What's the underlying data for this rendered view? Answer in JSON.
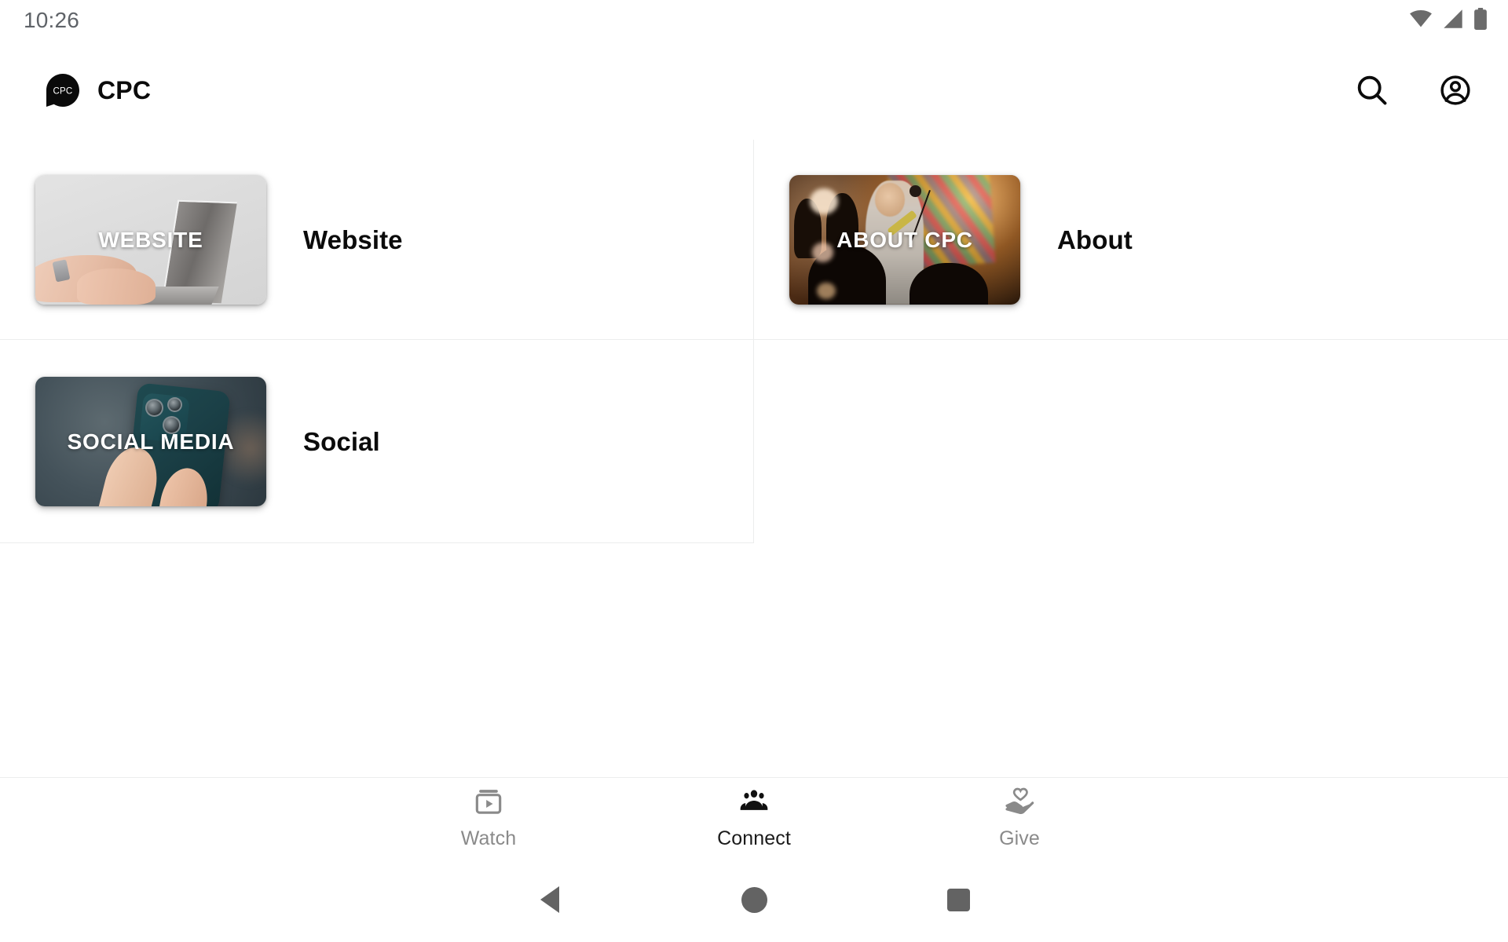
{
  "status_bar": {
    "time": "10:26",
    "icons": [
      "wifi-icon",
      "cellular-signal-icon",
      "battery-icon"
    ],
    "color": "#5f6368"
  },
  "app_bar": {
    "logo_text": "CPC",
    "logo_icon": "cpc-speech-bubble-logo",
    "title": "CPC",
    "actions": [
      {
        "name": "search-icon",
        "label": "Search"
      },
      {
        "name": "account-circle-icon",
        "label": "Account"
      }
    ]
  },
  "grid": {
    "divider_color": "#eceded",
    "items": [
      {
        "id": "website",
        "tile_label": "WEBSITE",
        "title": "Website",
        "image_alt": "hands typing on a laptop on a light grey desk"
      },
      {
        "id": "about",
        "tile_label": "ABOUT CPC",
        "title": "About",
        "image_alt": "worship band on stage with raised hands and warm stage lights"
      },
      {
        "id": "social",
        "tile_label": "SOCIAL MEDIA",
        "title": "Social",
        "image_alt": "hand holding a dark teal smartphone showing its camera module"
      }
    ]
  },
  "bottom_nav": {
    "items": [
      {
        "id": "watch",
        "label": "Watch",
        "icon": "video-library-icon",
        "active": false
      },
      {
        "id": "connect",
        "label": "Connect",
        "icon": "people-group-icon",
        "active": true
      },
      {
        "id": "give",
        "label": "Give",
        "icon": "hand-heart-icon",
        "active": false
      }
    ],
    "active_color": "#1b1b1b",
    "inactive_color": "#8a8a8a"
  },
  "system_nav": {
    "buttons": [
      {
        "id": "back",
        "icon": "back-triangle-icon"
      },
      {
        "id": "home",
        "icon": "home-circle-icon"
      },
      {
        "id": "recents",
        "icon": "recents-square-icon"
      }
    ],
    "color": "#636363"
  }
}
